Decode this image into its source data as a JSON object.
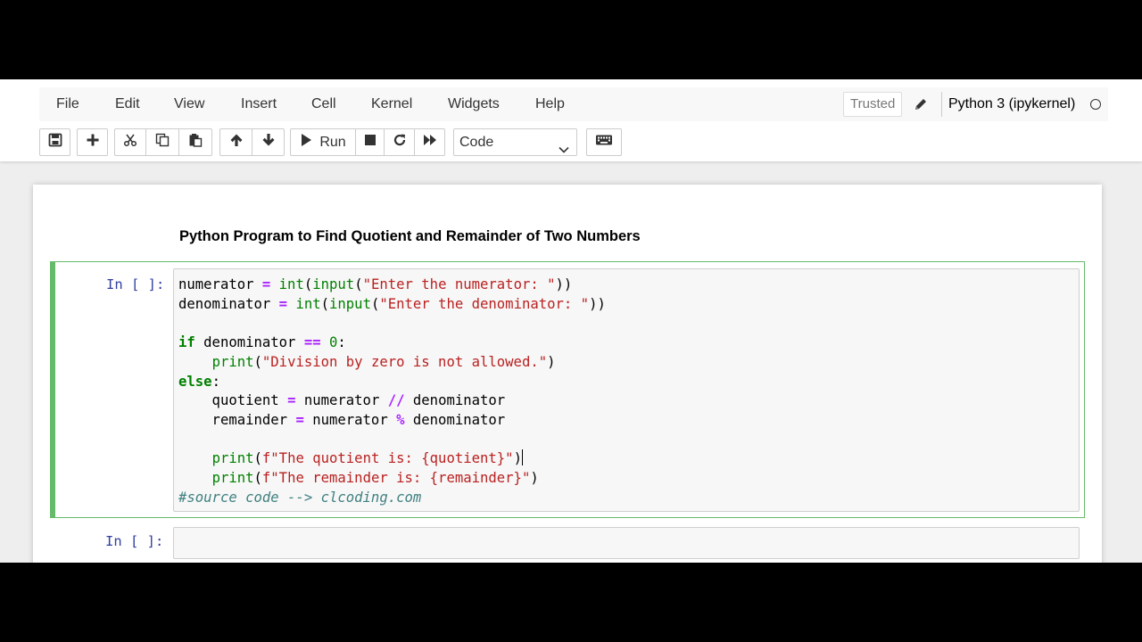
{
  "menu": {
    "items": [
      "File",
      "Edit",
      "View",
      "Insert",
      "Cell",
      "Kernel",
      "Widgets",
      "Help"
    ],
    "trusted_label": "Trusted",
    "kernel_name": "Python 3 (ipykernel)"
  },
  "toolbar": {
    "run_label": "Run",
    "cell_type": "Code",
    "icons": [
      "save-icon",
      "plus-icon",
      "scissors-icon",
      "copy-icon",
      "paste-icon",
      "arrow-up-icon",
      "arrow-down-icon",
      "play-icon",
      "stop-icon",
      "restart-icon",
      "fast-forward-icon",
      "keyboard-icon"
    ]
  },
  "notebook": {
    "markdown_heading": "Python Program to Find Quotient and Remainder of Two Numbers",
    "cells": [
      {
        "prompt": "In [ ]:",
        "code_lines": [
          "numerator = int(input(\"Enter the numerator: \"))",
          "denominator = int(input(\"Enter the denominator: \"))",
          "",
          "if denominator == 0:",
          "    print(\"Division by zero is not allowed.\")",
          "else:",
          "    quotient = numerator // denominator",
          "    remainder = numerator % denominator",
          "",
          "    print(f\"The quotient is: {quotient}\")",
          "    print(f\"The remainder is: {remainder}\")",
          "#source code --> clcoding.com"
        ]
      },
      {
        "prompt": "In [ ]:",
        "code_lines": []
      }
    ]
  },
  "colors": {
    "selected_cell_border": "#66bb6a",
    "keyword": "#008000",
    "string": "#ba2121",
    "operator": "#aa22ff",
    "comment": "#408080",
    "prompt": "#303f9f"
  }
}
